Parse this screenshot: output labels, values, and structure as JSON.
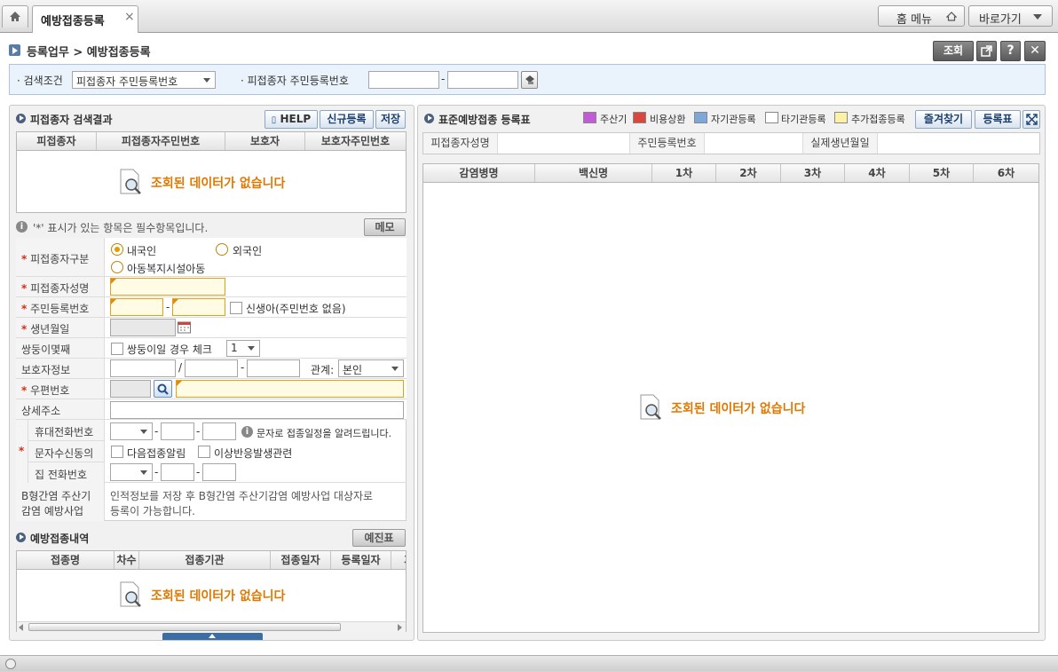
{
  "tabs": {
    "active_label": "예방접종등록",
    "close_symbol": "×"
  },
  "topbar": {
    "home_menu_label": "홈 메뉴",
    "shortcut_label": "바로가기"
  },
  "breadcrumb": {
    "text": "등록업무 > 예방접종등록"
  },
  "header_buttons": {
    "search_label": "조회",
    "close_symbol": "✕",
    "help_symbol": "?"
  },
  "search": {
    "condition_label": "검색조건",
    "condition_value": "피접종자 주민등록번호",
    "rrn_label": "피접종자 주민등록번호",
    "separator": "-"
  },
  "results_panel": {
    "title": "피접종자 검색결과",
    "help_label": "HELP",
    "new_label": "신규등록",
    "save_label": "저장",
    "columns": [
      "피접종자",
      "피접종자주민번호",
      "보호자",
      "보호자주민번호"
    ],
    "empty_text": "조회된 데이터가 없습니다"
  },
  "form": {
    "notice": "'*' 표시가 있는 항목은 필수항목입니다.",
    "memo_label": "메모",
    "type_label": "피접종자구분",
    "type_options": [
      "내국인",
      "외국인",
      "아동복지시설아동"
    ],
    "name_label": "피접종자성명",
    "rrn_label": "주민등록번호",
    "newborn_label": "신생아(주민번호 없음)",
    "birth_label": "생년월일",
    "twin_label": "쌍둥이몇째",
    "twin_check_label": "쌍둥이일 경우 체크",
    "twin_select": "1",
    "guardian_label": "보호자정보",
    "relation_label": "관계:",
    "relation_value": "본인",
    "zip_label": "우편번호",
    "address_label": "상세주소",
    "mobile_label": "휴대전화번호",
    "sms_info": "문자로 접종일정을 알려드립니다.",
    "sms_consent_label": "문자수신동의",
    "next_vacc_label": "다음접종알림",
    "adverse_label": "이상반응발생관련",
    "home_phone_label": "집 전화번호",
    "hepb_label_1": "B형간염 주산기",
    "hepb_label_2": "감염 예방사업",
    "hepb_text_1": "인적정보를 저장 후 B형간염 주산기감염 예방사업 대상자로",
    "hepb_text_2": "등록이 가능합니다.",
    "slash": "/",
    "dash": "-"
  },
  "history_panel": {
    "title": "예방접종내역",
    "pre_exam_label": "예진표",
    "columns": [
      "접종명",
      "차수",
      "접종기관",
      "접종일자",
      "등록일자",
      "기"
    ],
    "empty_text": "조회된 데이터가 없습니다"
  },
  "schedule_panel": {
    "title": "표준예방접종 등록표",
    "legend": [
      {
        "label": "주산기",
        "color": "#c25bd6"
      },
      {
        "label": "비용상환",
        "color": "#d9463e"
      },
      {
        "label": "자기관등록",
        "color": "#7ba7d9"
      },
      {
        "label": "타기관등록",
        "color": "#ffffff"
      },
      {
        "label": "추가접종등록",
        "color": "#fdf1a6"
      }
    ],
    "favorites_label": "즐겨찾기",
    "register_table_label": "등록표",
    "info_labels": [
      "피접종자성명",
      "주민등록번호",
      "실제생년월일"
    ],
    "columns": [
      "감염병명",
      "백신명",
      "1차",
      "2차",
      "3차",
      "4차",
      "5차",
      "6차"
    ],
    "empty_text": "조회된 데이터가 없습니다"
  }
}
